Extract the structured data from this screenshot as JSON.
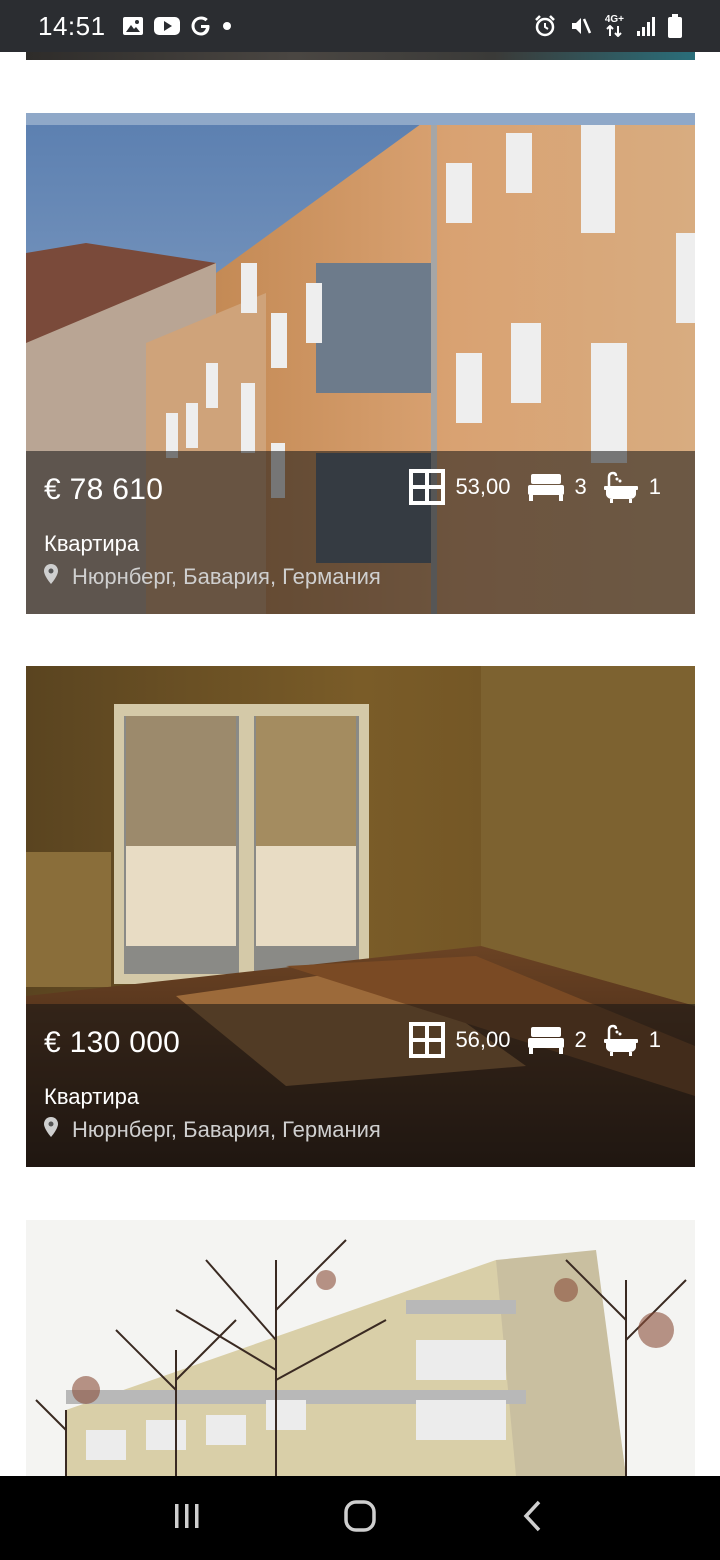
{
  "status_bar": {
    "time": "14:51",
    "left_icons": [
      "gallery-icon",
      "youtube-icon",
      "google-icon",
      "dot-icon"
    ],
    "right_icons": [
      "alarm-icon",
      "mute-icon",
      "network-4g-icon",
      "signal-icon",
      "battery-icon"
    ],
    "network_label": "4G+"
  },
  "listings": [
    {
      "price": "€ 78 610",
      "area": "53,00",
      "bedrooms": "3",
      "bathrooms": "1",
      "type": "Квартира",
      "location": "Нюрнберг, Бавария, Германия"
    },
    {
      "price": "€ 130 000",
      "area": "56,00",
      "bedrooms": "2",
      "bathrooms": "1",
      "type": "Квартира",
      "location": "Нюрнберг, Бавария, Германия"
    }
  ],
  "nav_bar": {
    "buttons": [
      "recent-apps",
      "home",
      "back"
    ]
  },
  "colors": {
    "status_bar_bg": "#2b2d31",
    "overlay": "rgba(20,20,20,0.55)",
    "nav_bar_bg": "#000000"
  }
}
